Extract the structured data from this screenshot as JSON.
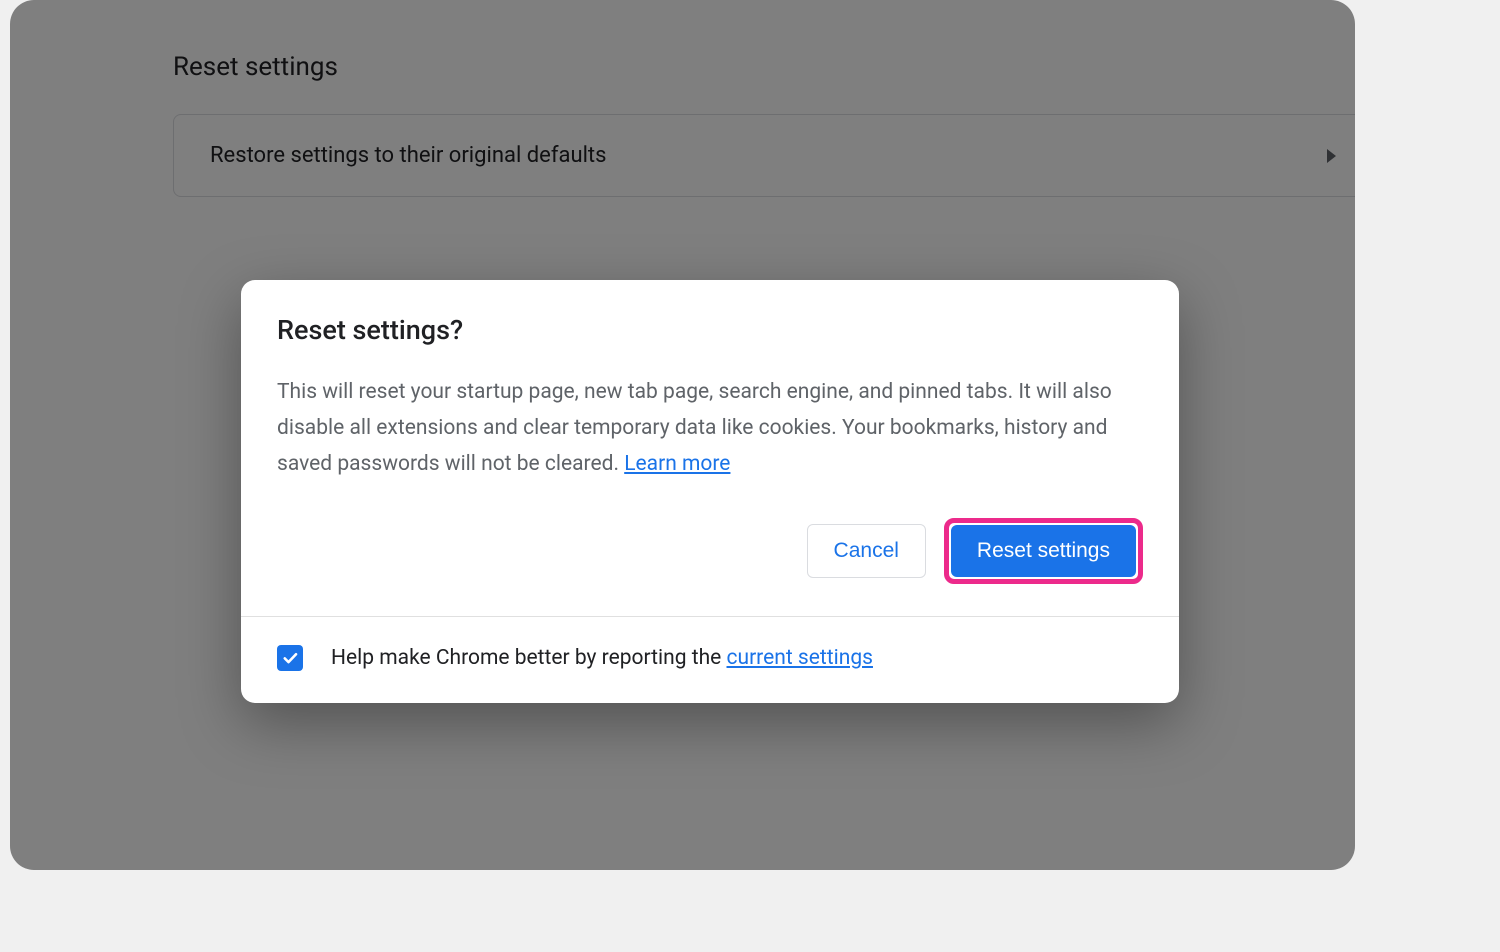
{
  "background": {
    "section_title": "Reset settings",
    "card_label": "Restore settings to their original defaults"
  },
  "dialog": {
    "title": "Reset settings?",
    "body_text": "This will reset your startup page, new tab page, search engine, and pinned tabs. It will also disable all extensions and clear temporary data like cookies. Your bookmarks, history and saved passwords will not be cleared. ",
    "learn_more": "Learn more",
    "cancel_label": "Cancel",
    "reset_label": "Reset settings"
  },
  "footer": {
    "text_prefix": "Help make Chrome better by reporting the ",
    "link_text": "current settings",
    "checkbox_checked": true
  },
  "colors": {
    "accent": "#1a73e8",
    "highlight": "#ec2a8b"
  }
}
